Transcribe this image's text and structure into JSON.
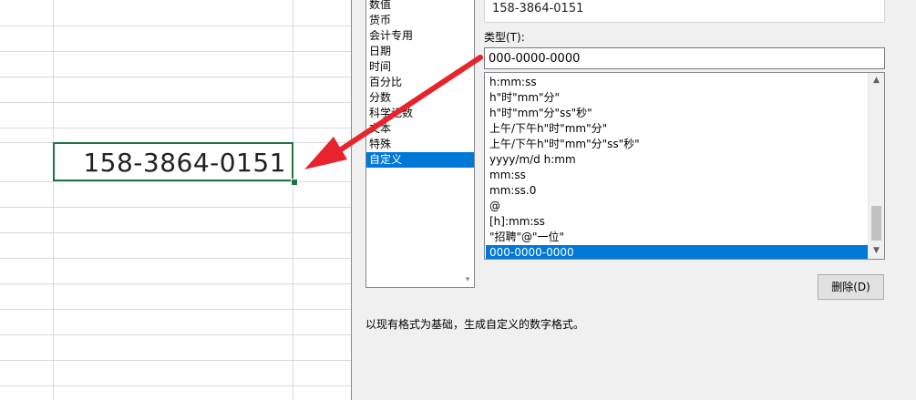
{
  "sheet": {
    "cell_value": "158-3864-0151"
  },
  "dialog": {
    "sample_value": "158-3864-0151",
    "categories": [
      "数值",
      "货币",
      "会计专用",
      "日期",
      "时间",
      "百分比",
      "分数",
      "科学记数",
      "文本",
      "特殊",
      "自定义"
    ],
    "selected_category": "自定义",
    "type_label": "类型(T):",
    "type_value": "000-0000-0000",
    "formats": [
      "h:mm:ss",
      "h\"时\"mm\"分\"",
      "h\"时\"mm\"分\"ss\"秒\"",
      "上午/下午h\"时\"mm\"分\"",
      "上午/下午h\"时\"mm\"分\"ss\"秒\"",
      "yyyy/m/d h:mm",
      "mm:ss",
      "mm:ss.0",
      "@",
      "[h]:mm:ss",
      "\"招聘\"@\"一位\"",
      "000-0000-0000"
    ],
    "selected_format": "000-0000-0000",
    "delete_label": "删除(D)",
    "description": "以现有格式为基础，生成自定义的数字格式。"
  },
  "colors": {
    "selection": "#0078d7",
    "cell_border": "#217346",
    "arrow": "#e8232d"
  }
}
